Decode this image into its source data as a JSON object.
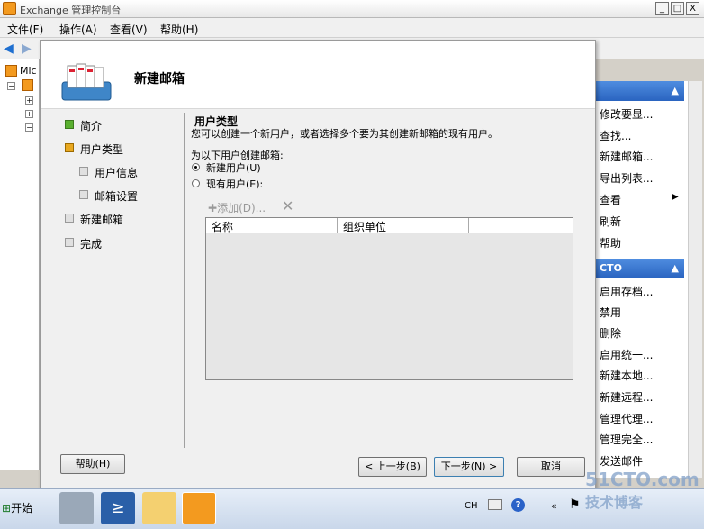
{
  "window": {
    "title": "Exchange 管理控制台",
    "min": "_",
    "max": "□",
    "close": "X"
  },
  "menu": [
    "文件(F)",
    "操作(A)",
    "查看(V)",
    "帮助(H)"
  ],
  "tree": {
    "root_label": "Mic"
  },
  "dialog": {
    "title": "新建邮箱",
    "steps": [
      {
        "label": "简介",
        "state": "done"
      },
      {
        "label": "用户类型",
        "state": "current"
      },
      {
        "label": "用户信息",
        "state": "pending"
      },
      {
        "label": "邮箱设置",
        "state": "pending"
      },
      {
        "label": "新建邮箱",
        "state": "pending"
      },
      {
        "label": "完成",
        "state": "pending"
      }
    ],
    "section_title": "用户类型",
    "section_desc": "您可以创建一个新用户，或者选择多个要为其创建新邮箱的现有用户。",
    "for_label": "为以下用户创建邮箱:",
    "radio_new": "新建用户(U)",
    "radio_existing": "现有用户(E):",
    "add_label": "添加(D)...",
    "columns": [
      "名称",
      "组织单位"
    ],
    "help_button": "帮助(H)",
    "back_button": "< 上一步(B)",
    "next_button": "下一步(N) >",
    "cancel_button": "取消"
  },
  "actions": {
    "group1_items": [
      "修改要显...",
      "查找...",
      "新建邮箱...",
      "导出列表...",
      "查看",
      "刷新",
      "帮助"
    ],
    "group2_title": "CTO",
    "group2_items": [
      "启用存档...",
      "禁用",
      "删除",
      "启用统一...",
      "新建本地...",
      "新建远程...",
      "管理代理...",
      "管理完全...",
      "发送邮件"
    ]
  },
  "taskbar": {
    "start_label": "开始",
    "lang": "CH"
  },
  "watermark": {
    "line1": "51CTO.com",
    "line2": "技术博客"
  }
}
